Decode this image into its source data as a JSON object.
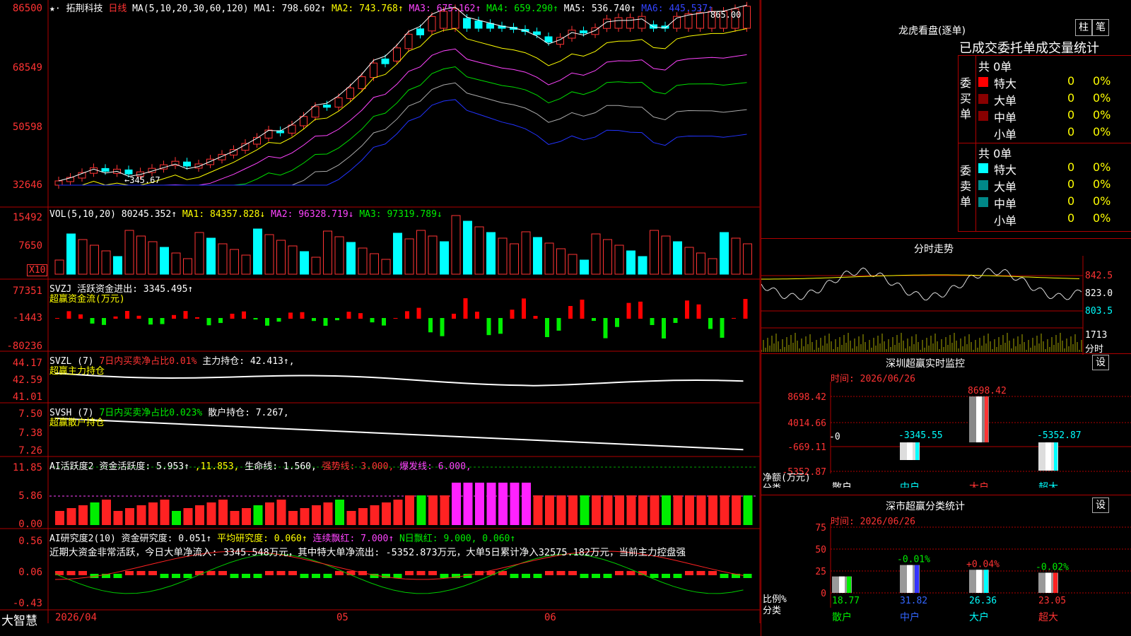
{
  "stock": {
    "name": "拓荆科技",
    "period": "日线",
    "ma_label": "MA(5,10,20,30,60,120)",
    "ma1": "MA1: 798.602↑",
    "ma2": "MA2: 743.768↑",
    "ma3": "MA3: 675.162↑",
    "ma4": "MA4: 659.290↑",
    "ma5": "MA5: 536.740↑",
    "ma6": "MA6: 445.537↑",
    "high_label": "865.00",
    "low_label": "←345.67"
  },
  "price_axis": [
    "86500",
    "68549",
    "50598",
    "32646"
  ],
  "vol": {
    "label": "VOL(5,10,20)",
    "v": "80245.352↑",
    "ma1": "MA1: 84357.828↓",
    "ma2": "MA2: 96328.719↓",
    "ma3": "MA3: 97319.789↓",
    "axis": [
      "15492",
      "7650"
    ],
    "unit": "X10"
  },
  "svzj": {
    "label": "SVZJ",
    "title": "活跃资金进出: 3345.495↑",
    "sub": "超赢资金流(万元)",
    "axis": [
      "77351",
      "-1443",
      "-80236"
    ]
  },
  "svzl": {
    "label": "SVZL (7)",
    "ratio": "7日内买卖净占比0.01%",
    "hold": "主力持仓: 42.413↑,",
    "sub": "超赢主力持仓",
    "axis": [
      "44.17",
      "42.59",
      "41.01"
    ]
  },
  "svsh": {
    "label": "SVSH (7)",
    "ratio": "7日内买卖净占比0.023%",
    "hold": "散户持仓: 7.267,",
    "sub": "超赢散户持仓",
    "axis": [
      "7.50",
      "7.38",
      "7.26"
    ]
  },
  "ai1": {
    "label": "AI活跃度2",
    "a": "资金活跃度: 5.953↑",
    "b": ",11.853,",
    "c": "生命线: 1.560,",
    "d": "强势线: 3.000,",
    "e": "爆发线: 6.000,",
    "axis": [
      "11.85",
      "5.86",
      "0.00"
    ]
  },
  "ai2": {
    "label": "AI研究度2(10)",
    "a": "资金研究度: 0.051↑",
    "b": "平均研究度: 0.060↑",
    "c": "连续飘红: 7.000↑",
    "d": "N日飘红: 9.000, 0.060↑",
    "note": "近期大资金非常活跃，今日大单净流入: 3345.548万元，其中特大单净流出: -5352.873万元，大单5日累计净入32575.182万元，当前主力控盘强",
    "axis": [
      "0.56",
      "0.06",
      "-0.43"
    ]
  },
  "date_axis": {
    "brand": "大智慧",
    "d0": "2026/04",
    "d1": "05",
    "d2": "06"
  },
  "side": {
    "lhkp_title": "龙虎看盘(逐单)",
    "btn1": "柱",
    "btn2": "笔",
    "tabs": "已成交委托单成交量统计",
    "buy_label": "委买单",
    "sell_label": "委卖单",
    "buy_total": "共 0单",
    "sell_total": "共 0单",
    "buy_rows": [
      {
        "name": "特大",
        "n": "0",
        "p": "0%"
      },
      {
        "name": "大单",
        "n": "0",
        "p": "0%"
      },
      {
        "name": "中单",
        "n": "0",
        "p": "0%"
      },
      {
        "name": "小单",
        "n": "0",
        "p": "0%"
      }
    ],
    "sell_rows": [
      {
        "name": "特大",
        "n": "0",
        "p": "0%"
      },
      {
        "name": "大单",
        "n": "0",
        "p": "0%"
      },
      {
        "name": "中单",
        "n": "0",
        "p": "0%"
      },
      {
        "name": "小单",
        "n": "0",
        "p": "0%"
      }
    ],
    "fenshi_title": "分时走势",
    "fenshi_axis": [
      "842.5",
      "823.0",
      "803.5",
      "1713"
    ],
    "fenshi_unit": "分时",
    "sz_title": "深圳超赢实时监控",
    "sz_date": "时间: 2026/06/26",
    "sz_set": "设",
    "sz_axis": [
      "8698.42",
      "4014.66",
      "-669.11",
      "-5352.87"
    ],
    "sz_ylabel1": "净额(万元)",
    "sz_ylabel2": "分类",
    "sz_bars": [
      {
        "cat": "散户",
        "val": "-0",
        "color": "#fff"
      },
      {
        "cat": "中户",
        "val": "-3345.55",
        "color": "#00ffff"
      },
      {
        "cat": "大户",
        "val": "8698.42",
        "color": "#ff3333"
      },
      {
        "cat": "超大",
        "val": "-5352.87",
        "color": "#00ffff"
      }
    ],
    "ss_title": "深市超赢分类统计",
    "ss_date": "时间: 2026/06/26",
    "ss_set": "设",
    "ss_axis": [
      "75",
      "50",
      "25",
      "0"
    ],
    "ss_ylabel1": "比例%",
    "ss_ylabel2": "分类",
    "ss_bars": [
      {
        "cat": "散户",
        "val": "18.77",
        "chg": ""
      },
      {
        "cat": "中户",
        "val": "31.82",
        "chg": "-0.01%"
      },
      {
        "cat": "大户",
        "val": "26.36",
        "chg": "+0.04%"
      },
      {
        "cat": "超大",
        "val": "23.05",
        "chg": "-0.02%"
      }
    ]
  }
}
